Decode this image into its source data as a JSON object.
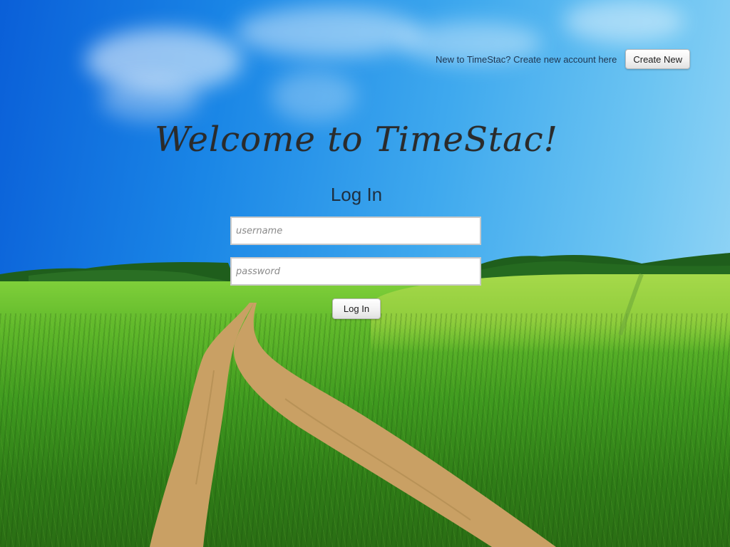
{
  "app": {
    "title": "Welcome to TimeStac!"
  },
  "signup": {
    "prompt": "New to TimeStac? Create new account here",
    "button_label": "Create New"
  },
  "login": {
    "heading": "Log In",
    "username_placeholder": "username",
    "password_placeholder": "password",
    "submit_label": "Log In"
  },
  "background": {
    "description_icon": "meadow-path-landscape",
    "colors": {
      "sky": "#1a86e6",
      "grass": "#3f9a1f",
      "path": "#c9a064"
    }
  }
}
